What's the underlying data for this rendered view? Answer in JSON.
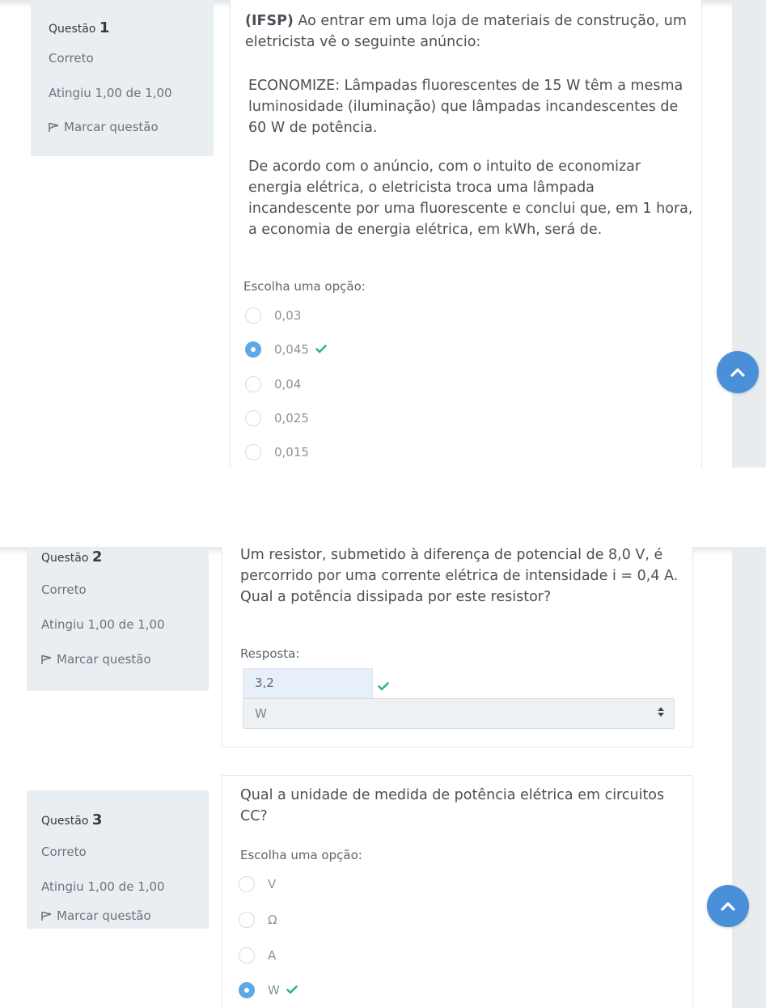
{
  "questions": [
    {
      "label": "Questão",
      "number": "1",
      "state": "Correto",
      "grade": "Atingiu 1,00 de 1,00",
      "flag_label": "Marcar questão",
      "source": "(IFSP)",
      "text_1": " Ao entrar em uma loja de materiais de construção, um eletricista vê o seguinte anúncio:",
      "text_2": "ECONOMIZE: Lâmpadas fluorescentes de 15 W têm a mesma luminosidade (iluminação) que lâmpadas incandescentes de 60 W de potência.",
      "text_3": "De acordo com o anúncio, com o intuito de economizar energia elétrica, o eletricista troca uma lâmpada incandescente por uma fluorescente e conclui que, em 1 hora, a economia de energia elétrica, em kWh, será de.",
      "prompt": "Escolha uma opção:",
      "options": [
        "0,03",
        "0,045",
        "0,04",
        "0,025",
        "0,015"
      ],
      "selected": "0,045"
    },
    {
      "label": "Questão",
      "number": "2",
      "state": "Correto",
      "grade": "Atingiu 1,00 de 1,00",
      "flag_label": "Marcar questão",
      "text": "Um resistor, submetido à diferença de potencial de 8,0 V, é percorrido por uma corrente elétrica de intensidade i = 0,4 A. Qual a potência dissipada por este resistor?",
      "prompt": "Resposta:",
      "answer_value": "3,2",
      "unit_selected": "W"
    },
    {
      "label": "Questão",
      "number": "3",
      "state": "Correto",
      "grade": "Atingiu 1,00 de 1,00",
      "flag_label": "Marcar questão",
      "text": "Qual a unidade de medida de potência elétrica em circuitos CC?",
      "prompt": "Escolha uma opção:",
      "options": [
        "V",
        "Ω",
        "A",
        "W"
      ],
      "selected": "W"
    }
  ],
  "colors": {
    "accent_blue": "#4a90d9",
    "radio_selected": "#5fa8e6",
    "correct_check": "#2fb67c",
    "info_background": "#e9eef2"
  },
  "icons": {
    "flag": "flag-icon",
    "check": "check-icon",
    "back_to_top": "chevron-up-icon",
    "select_arrows": "sort-arrows-icon"
  }
}
